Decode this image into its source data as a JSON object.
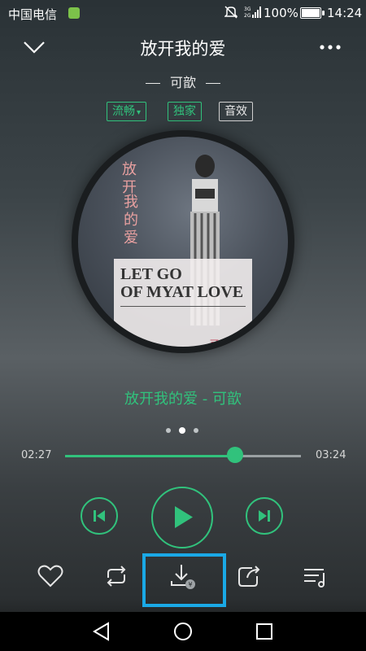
{
  "status_bar": {
    "carrier": "中国电信",
    "battery": "100%",
    "time": "14:24",
    "icons": [
      "sim-icon",
      "mute-icon",
      "signal-icon",
      "battery-icon"
    ]
  },
  "header": {
    "title": "放开我的爱",
    "artist": "可歆"
  },
  "tags": [
    {
      "label": "流畅",
      "has_dropdown": true,
      "color": "#31c27c"
    },
    {
      "label": "独家",
      "color": "#31c27c"
    },
    {
      "label": "音效",
      "color": "#d0d0d0"
    }
  ],
  "album_art": {
    "vertical_title": "放开",
    "vertical_title2": "我的爱",
    "line1": "LET GO",
    "line2": "OF MYAT LOVE",
    "artist": "可 ◯ 歆"
  },
  "track_display": "放开我的爱 - 可歆",
  "pager": {
    "count": 3,
    "active": 1
  },
  "progress": {
    "current": "02:27",
    "total": "03:24",
    "fraction": 0.72
  },
  "controls": [
    "previous",
    "play",
    "next"
  ],
  "actions": [
    "like",
    "repeat",
    "download",
    "share",
    "playlist"
  ],
  "nav": [
    "back",
    "home",
    "recents"
  ],
  "colors": {
    "accent": "#31c27c",
    "highlight": "#1aa9e6"
  }
}
